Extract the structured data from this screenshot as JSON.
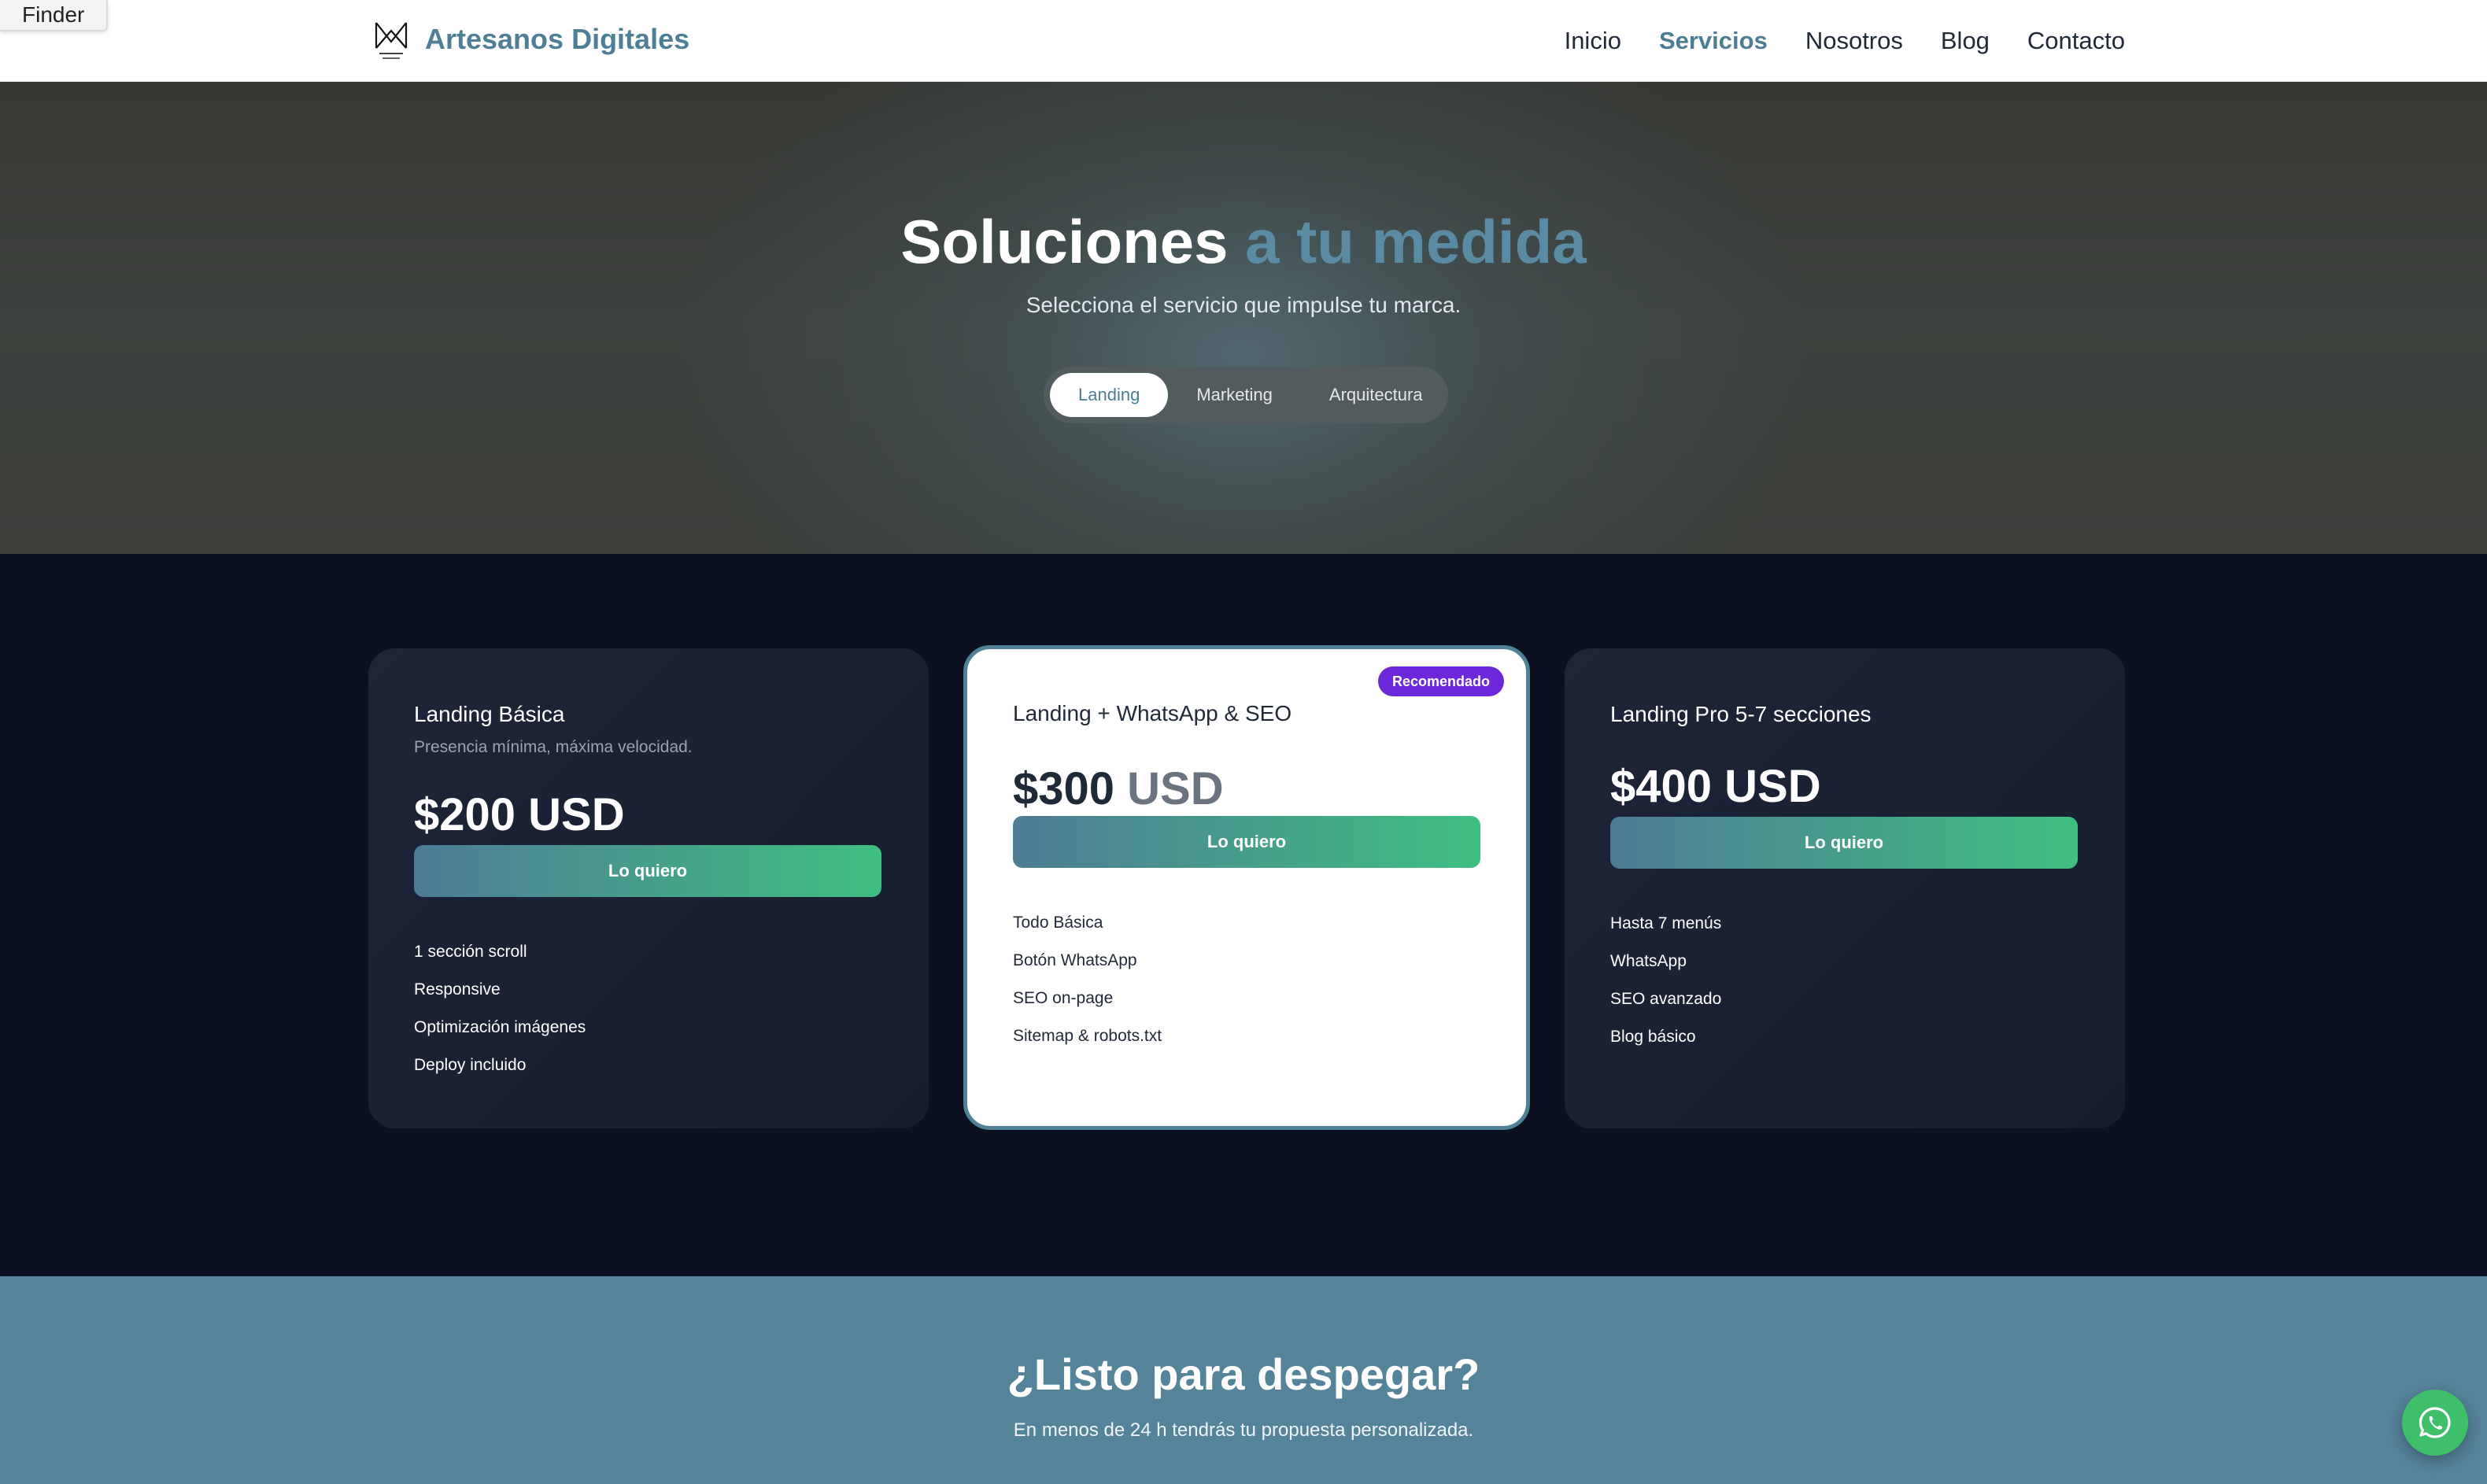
{
  "finder": {
    "label": "Finder"
  },
  "header": {
    "brand": "Artesanos Digitales",
    "nav": [
      "Inicio",
      "Servicios",
      "Nosotros",
      "Blog",
      "Contacto"
    ],
    "active_nav": "Servicios"
  },
  "hero": {
    "title_main": "Soluciones",
    "title_accent": "a tu medida",
    "subtitle": "Selecciona el servicio que impulse tu marca.",
    "tabs": [
      "Landing",
      "Marketing",
      "Arquitectura"
    ],
    "active_tab": "Landing"
  },
  "plans": [
    {
      "title": "Landing Básica",
      "description": "Presencia mínima, máxima velocidad.",
      "price_amount": "$200",
      "price_currency": "USD",
      "cta": "Lo quiero",
      "features": [
        "1 sección scroll",
        "Responsive",
        "Optimización imágenes",
        "Deploy incluido"
      ]
    },
    {
      "title": "Landing + WhatsApp & SEO",
      "badge": "Recomendado",
      "price_amount": "$300",
      "price_currency": "USD",
      "cta": "Lo quiero",
      "features": [
        "Todo Básica",
        "Botón WhatsApp",
        "SEO on-page",
        "Sitemap & robots.txt"
      ]
    },
    {
      "title": "Landing Pro 5-7 secciones",
      "price_amount": "$400",
      "price_currency": "USD",
      "cta": "Lo quiero",
      "features": [
        "Hasta 7 menús",
        "WhatsApp",
        "SEO avanzado",
        "Blog básico"
      ]
    }
  ],
  "cta_band": {
    "title": "¿Listo para despegar?",
    "subtitle": "En menos de 24 h tendrás tu propuesta personalizada."
  },
  "icons": {
    "brand_logo": "m-monogram-icon",
    "floating": "whatsapp-icon"
  },
  "colors": {
    "accent": "#5b8ba3",
    "badge": "#6d28d9",
    "cta_from": "#4d7c95",
    "cta_to": "#3fbf80",
    "whatsapp": "#3fbf6a"
  }
}
